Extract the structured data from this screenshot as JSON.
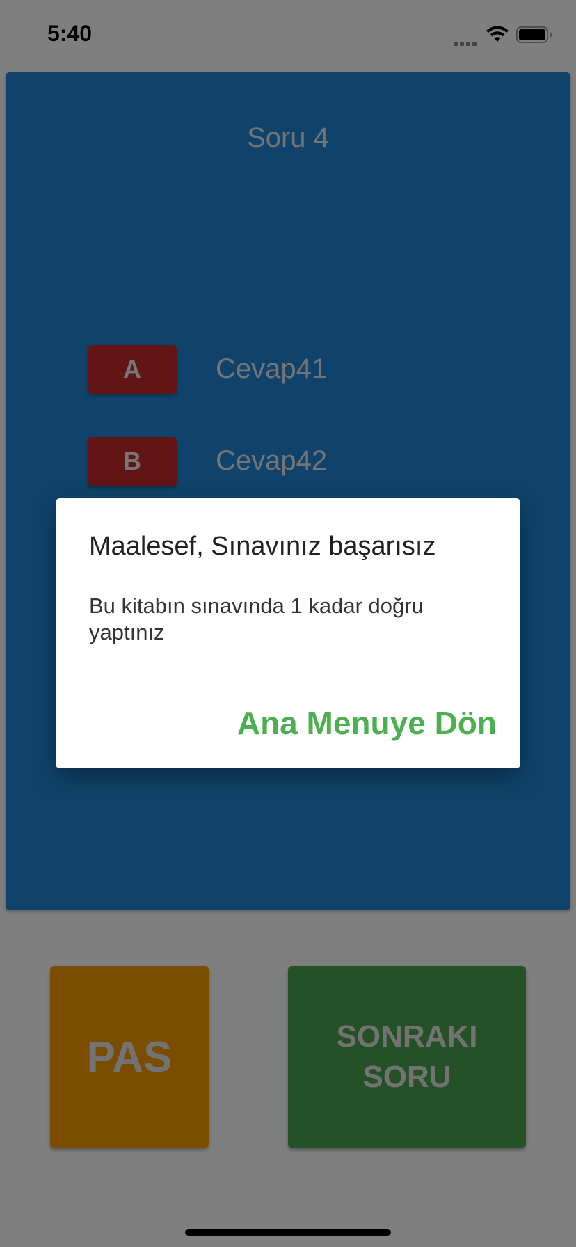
{
  "status_bar": {
    "time": "5:40"
  },
  "quiz": {
    "question_title": "Soru 4",
    "answers": [
      {
        "letter": "A",
        "text": "Cevap41"
      },
      {
        "letter": "B",
        "text": "Cevap42"
      }
    ],
    "card_color": "#1e86d6",
    "badge_color": "#c62828"
  },
  "buttons": {
    "pass_label": "PAS",
    "next_label": "SONRAKI SORU",
    "pass_color": "#f59b00",
    "next_color": "#48a24c"
  },
  "dialog": {
    "title": "Maalesef, Sınavınız başarısız",
    "body": "Bu kitabın sınavında 1 kadar doğru yaptınız",
    "action_label": "Ana Menuye Dön",
    "action_color": "#4caf50"
  },
  "icons": {
    "signal": "cellular-signal-icon",
    "wifi": "wifi-icon",
    "battery": "battery-icon"
  }
}
